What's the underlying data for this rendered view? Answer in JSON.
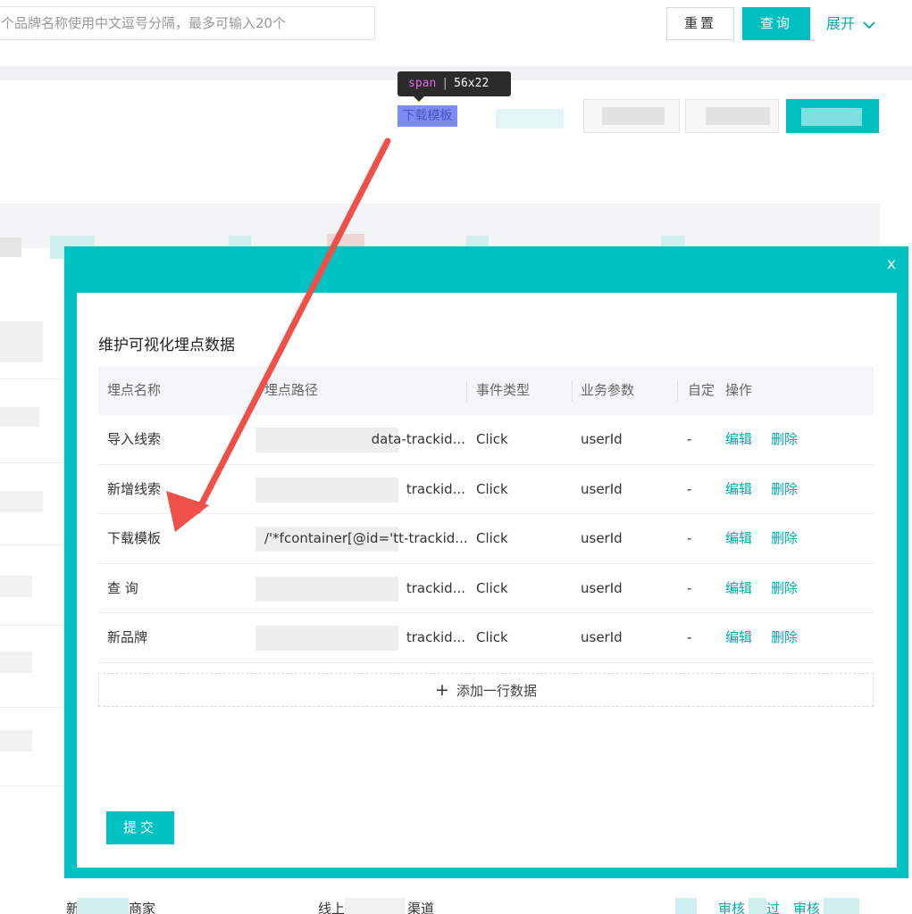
{
  "search": {
    "brand_placeholder": "个品牌名称使用中文逗号分隔，最多可输入20个",
    "reset_label": "重置",
    "query_label": "查询",
    "expand_label": "展开"
  },
  "toolbar": {
    "download_template_label": "下载模板"
  },
  "inspector": {
    "tag": "span",
    "sep": "|",
    "size": "56x22"
  },
  "modal": {
    "close_label": "x",
    "title": "维护可视化埋点数据",
    "columns": [
      "埋点名称",
      "埋点路径",
      "事件类型",
      "业务参数",
      "自定",
      "操作"
    ],
    "rows": [
      {
        "name": "导入线索",
        "path": "data-trackid...",
        "event": "Click",
        "param": "userId",
        "custom": "-",
        "edit": "编辑",
        "delete": "删除"
      },
      {
        "name": "新增线索",
        "path": "trackid...",
        "event": "Click",
        "param": "userId",
        "custom": "-",
        "edit": "编辑",
        "delete": "删除"
      },
      {
        "name": "下载模板",
        "path": "/'*fcontainer[@id='tt-trackid...",
        "event": "Click",
        "param": "userId",
        "custom": "-",
        "edit": "编辑",
        "delete": "删除"
      },
      {
        "name": "查 询",
        "path": "trackid...",
        "event": "Click",
        "param": "userId",
        "custom": "-",
        "edit": "编辑",
        "delete": "删除"
      },
      {
        "name": "新品牌",
        "path": "trackid...",
        "event": "Click",
        "param": "userId",
        "custom": "-",
        "edit": "编辑",
        "delete": "删除"
      }
    ],
    "add_row_label": "添加一行数据",
    "submit_label": "提交"
  },
  "background_table": {
    "bottom_row": {
      "col1": "新",
      "col1b": "商家",
      "col2": "线上",
      "col2b": "渠道",
      "review1": "审核",
      "review1b": "过",
      "review2": "审核"
    }
  },
  "colors": {
    "accent": "#00c1c1",
    "link": "#00a8ad",
    "arrow": "#f0504a",
    "highlight": "#7b8cf3"
  },
  "icons": {
    "expand": "chevron-down-icon",
    "add": "plus-icon",
    "close": "close-icon",
    "annotation": "red-arrow-icon"
  }
}
